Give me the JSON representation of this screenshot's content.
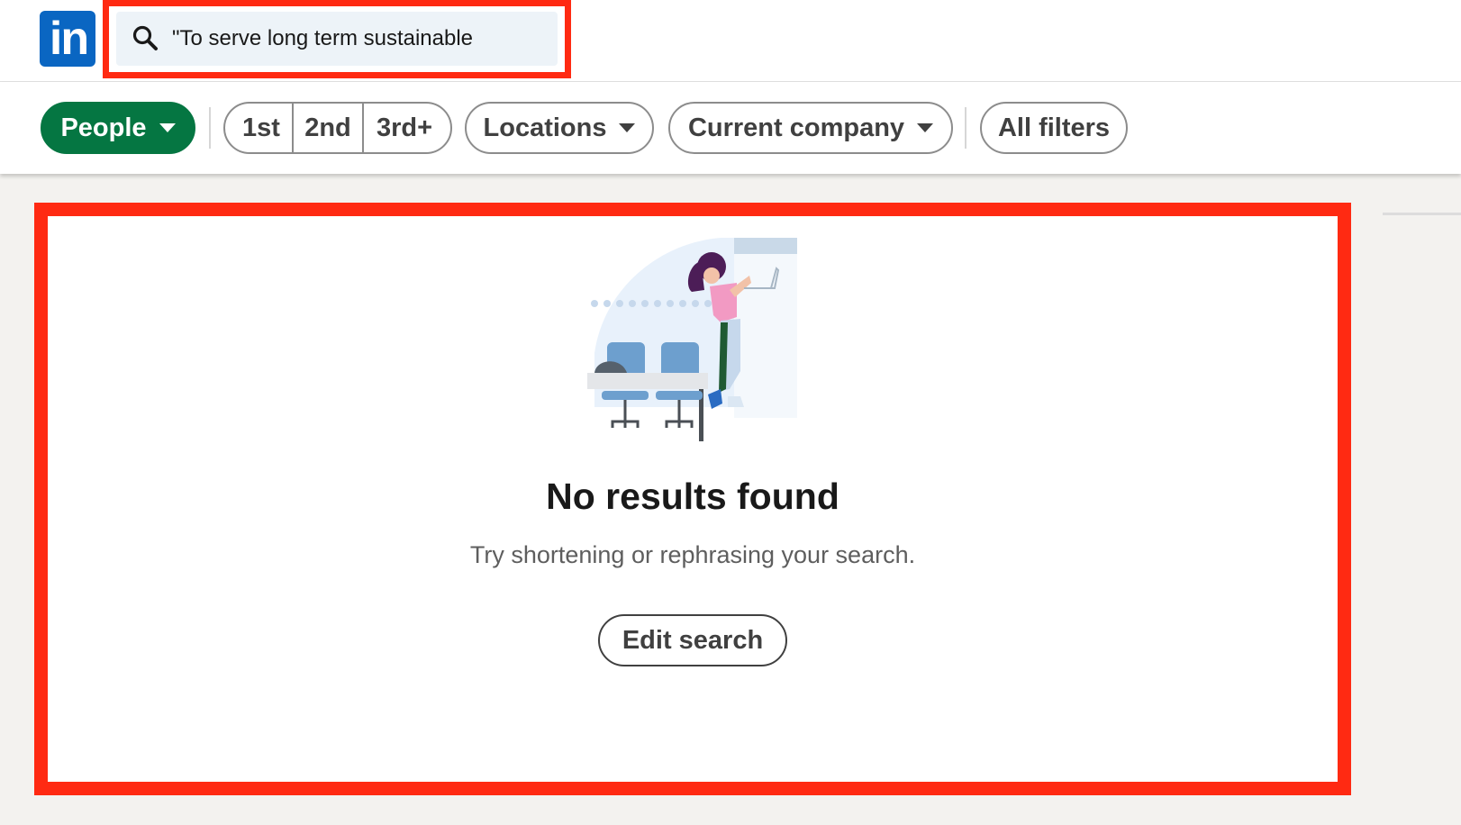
{
  "header": {
    "logo_text": "in",
    "search": {
      "value": "\"To serve long term sustainable",
      "icon": "search-icon"
    }
  },
  "filters": {
    "people_label": "People",
    "degrees": [
      "1st",
      "2nd",
      "3rd+"
    ],
    "locations_label": "Locations",
    "current_company_label": "Current company",
    "all_filters_label": "All filters"
  },
  "results": {
    "illustration": "empty-search-illustration",
    "title": "No results found",
    "subtitle": "Try shortening or rephrasing your search.",
    "edit_search_label": "Edit search"
  },
  "colors": {
    "linkedin_blue": "#0a66c2",
    "people_pill_green": "#057642",
    "highlight_red": "#ff2a12"
  }
}
